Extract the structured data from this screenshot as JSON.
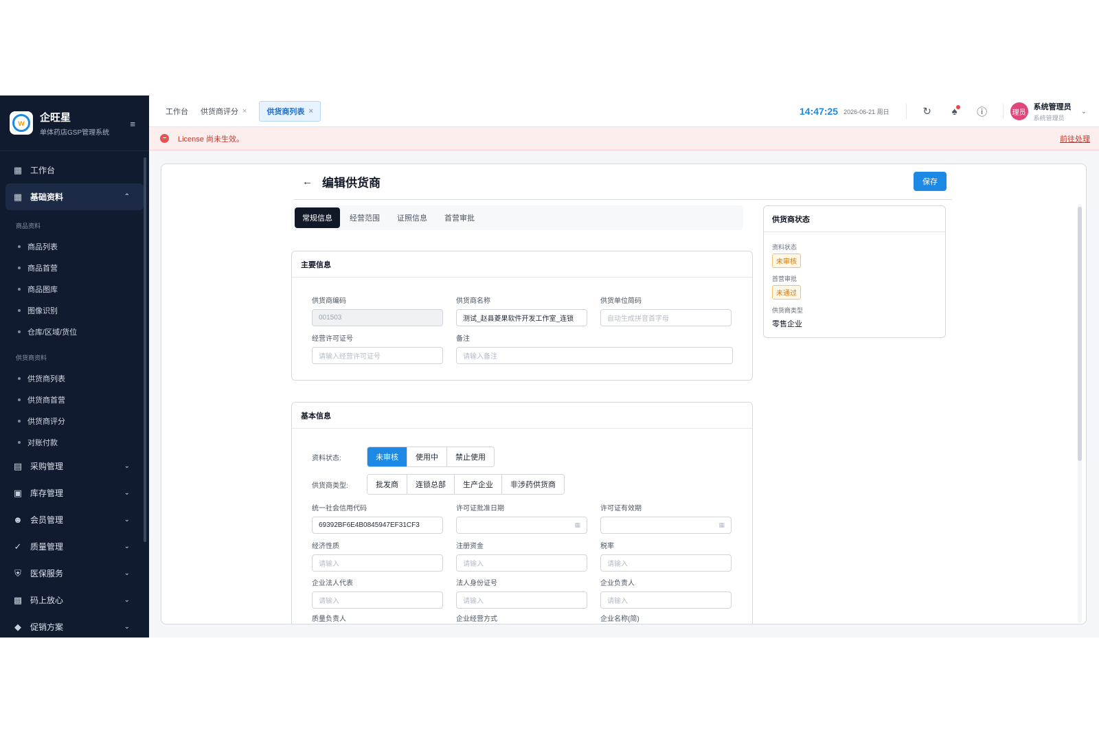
{
  "brand": {
    "name": "企旺星",
    "subtitle": "单体药店GSP管理系统"
  },
  "sidebar": {
    "items": [
      {
        "label": "工作台",
        "icon": "dashboard-icon"
      },
      {
        "label": "基础资料",
        "icon": "grid-icon"
      }
    ],
    "group_goods": "商品资料",
    "goods_items": [
      "商品列表",
      "商品首营",
      "商品图库",
      "图像识别",
      "仓库/区域/货位"
    ],
    "group_supplier": "供货商资料",
    "supplier_items": [
      "供货商列表",
      "供货商首营",
      "供货商评分",
      "对账付款"
    ],
    "modules": [
      {
        "label": "采购管理",
        "icon": "cart-icon"
      },
      {
        "label": "库存管理",
        "icon": "inventory-icon"
      },
      {
        "label": "会员管理",
        "icon": "members-icon"
      },
      {
        "label": "质量管理",
        "icon": "quality-icon"
      },
      {
        "label": "医保服务",
        "icon": "shield-icon"
      },
      {
        "label": "码上放心",
        "icon": "scan-icon"
      },
      {
        "label": "促销方案",
        "icon": "tag-icon"
      }
    ]
  },
  "topbar": {
    "tabs": [
      {
        "label": "工作台"
      },
      {
        "label": "供货商评分"
      },
      {
        "label": "供货商列表"
      }
    ],
    "close_glyph": "×",
    "time": "14:47:25",
    "date": "2026-06-21 周日",
    "avatar_text": "理员",
    "user_name": "系统管理员",
    "user_role": "系统管理员"
  },
  "alert": {
    "text": "License 尚未生效。",
    "link": "前往处理"
  },
  "page": {
    "title": "编辑供货商",
    "save_label": "保存",
    "tabs": [
      "常规信息",
      "经营范围",
      "证照信息",
      "首营审批"
    ]
  },
  "main_info": {
    "title": "主要信息",
    "code_label": "供货商编码",
    "code_value": "001503",
    "name_label": "供货商名称",
    "name_value": "测试_赵县菱果软件开发工作室_连锁",
    "abbr_label": "供货单位简码",
    "abbr_placeholder": "自动生成拼音首字母",
    "license_label": "经营许可证号",
    "license_placeholder": "请输入经营许可证号",
    "remark_label": "备注",
    "remark_placeholder": "请输入备注"
  },
  "basic_info": {
    "title": "基本信息",
    "status_label": "资料状态:",
    "status_options": [
      "未审核",
      "使用中",
      "禁止使用"
    ],
    "type_label": "供货商类型:",
    "type_options": [
      "批发商",
      "连锁总部",
      "生产企业",
      "非涉药供货商"
    ],
    "credit_label": "统一社会信用代码",
    "credit_value": "69392BF6E4B0845947EF31CF3",
    "approve_date_label": "许可证批准日期",
    "valid_label": "许可证有效期",
    "nature_label": "经济性质",
    "capital_label": "注册资金",
    "tax_label": "税率",
    "legal_label": "企业法人代表",
    "idcard_label": "法人身份证号",
    "owner_label": "企业负责人",
    "quality_label": "质量负责人",
    "mode_label": "企业经营方式",
    "short_name_label": "企业名称(简)",
    "placeholder": "请输入"
  },
  "status_panel": {
    "title": "供货商状态",
    "data_status_label": "资料状态",
    "data_status_value": "未审核",
    "approval_label": "首营审批",
    "approval_value": "未通过",
    "type_label": "供货商类型",
    "type_value": "零售企业"
  },
  "colors": {
    "accent": "#1e88e5",
    "sidebar_bg": "#101b30",
    "alert_bg": "#fdeeee",
    "warning": "#d97706"
  }
}
